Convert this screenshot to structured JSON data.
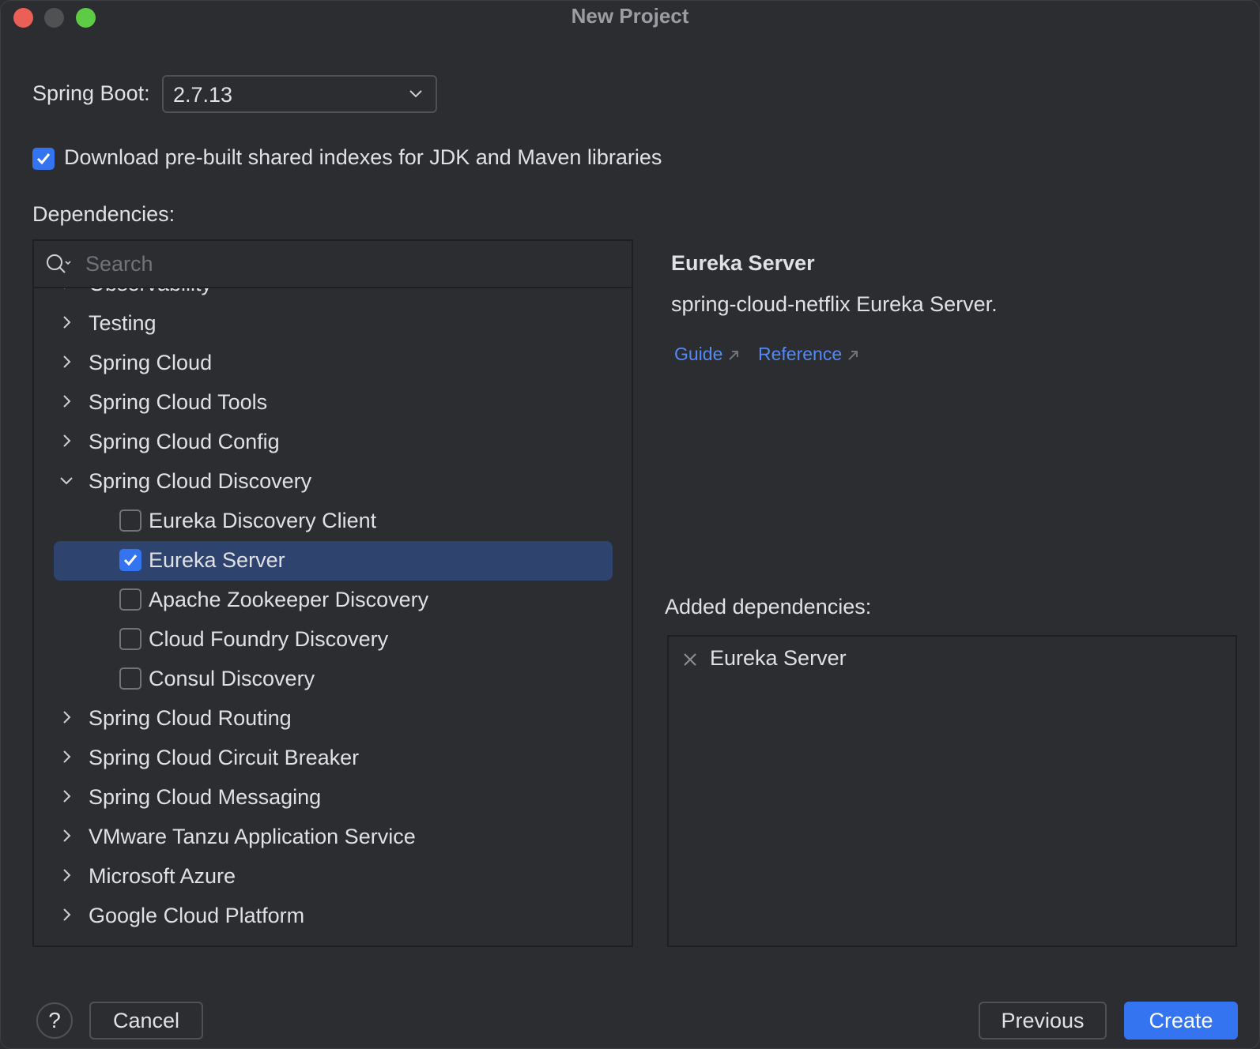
{
  "window": {
    "title": "New Project"
  },
  "spring_boot": {
    "label": "Spring Boot:",
    "selected_version": "2.7.13"
  },
  "download_indexes": {
    "label": "Download pre-built shared indexes for JDK and Maven libraries",
    "checked": true
  },
  "dependencies": {
    "label": "Dependencies:",
    "search_placeholder": "Search",
    "tree": [
      {
        "label": "Observability",
        "type": "category",
        "expanded": false
      },
      {
        "label": "Testing",
        "type": "category",
        "expanded": false
      },
      {
        "label": "Spring Cloud",
        "type": "category",
        "expanded": false
      },
      {
        "label": "Spring Cloud Tools",
        "type": "category",
        "expanded": false
      },
      {
        "label": "Spring Cloud Config",
        "type": "category",
        "expanded": false
      },
      {
        "label": "Spring Cloud Discovery",
        "type": "category",
        "expanded": true
      },
      {
        "label": "Eureka Discovery Client",
        "type": "item",
        "checked": false
      },
      {
        "label": "Eureka Server",
        "type": "item",
        "checked": true,
        "selected": true
      },
      {
        "label": "Apache Zookeeper Discovery",
        "type": "item",
        "checked": false
      },
      {
        "label": "Cloud Foundry Discovery",
        "type": "item",
        "checked": false
      },
      {
        "label": "Consul Discovery",
        "type": "item",
        "checked": false
      },
      {
        "label": "Spring Cloud Routing",
        "type": "category",
        "expanded": false
      },
      {
        "label": "Spring Cloud Circuit Breaker",
        "type": "category",
        "expanded": false
      },
      {
        "label": "Spring Cloud Messaging",
        "type": "category",
        "expanded": false
      },
      {
        "label": "VMware Tanzu Application Service",
        "type": "category",
        "expanded": false
      },
      {
        "label": "Microsoft Azure",
        "type": "category",
        "expanded": false
      },
      {
        "label": "Google Cloud Platform",
        "type": "category",
        "expanded": false
      }
    ]
  },
  "details": {
    "title": "Eureka Server",
    "description": "spring-cloud-netflix Eureka Server.",
    "guide_link": "Guide",
    "reference_link": "Reference"
  },
  "added_dependencies": {
    "label": "Added dependencies:",
    "items": [
      "Eureka Server"
    ]
  },
  "buttons": {
    "help": "?",
    "cancel": "Cancel",
    "previous": "Previous",
    "create": "Create"
  },
  "colors": {
    "background": "#2b2d30",
    "accent": "#3574f0",
    "selection": "#2e436e",
    "link": "#548af7"
  }
}
